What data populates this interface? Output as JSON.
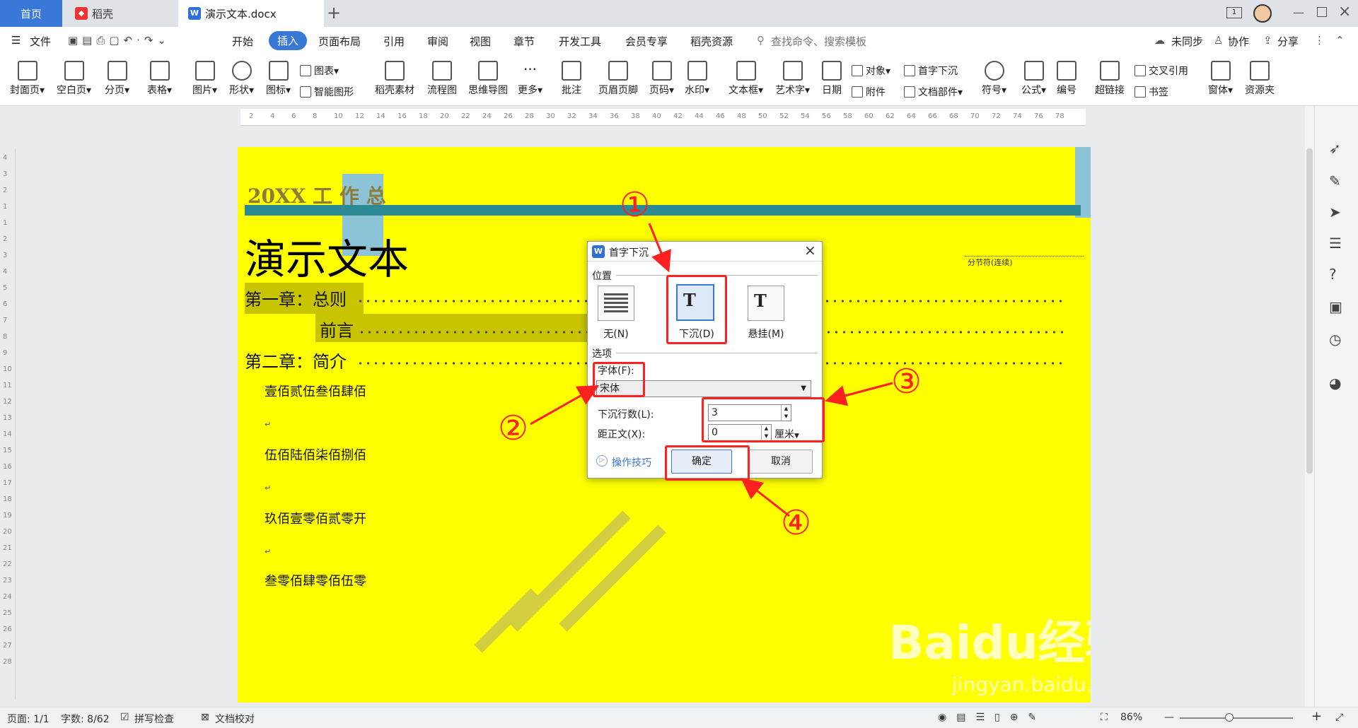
{
  "titlebar": {
    "home": "首页",
    "daoke": "稻壳",
    "doc_tab": "演示文本.docx",
    "add_tab": "+",
    "badge": "1"
  },
  "menu": {
    "file": "文件",
    "start": "开始",
    "insert": "插入",
    "layout": "页面布局",
    "ref": "引用",
    "review": "审阅",
    "view": "视图",
    "chapter": "章节",
    "dev": "开发工具",
    "member": "会员专享",
    "daoke_res": "稻壳资源",
    "search": "查找命令、搜索模板",
    "sync": "未同步",
    "collab": "协作",
    "share": "分享"
  },
  "ribbon": {
    "cover": "封面页",
    "blank": "空白页",
    "pagebreak": "分页",
    "table": "表格",
    "picture": "图片",
    "shape": "形状",
    "icon": "图标",
    "chart": "图表",
    "smartart": "智能图形",
    "material": "稻壳素材",
    "flow": "流程图",
    "mind": "思维导图",
    "more": "更多",
    "comment": "批注",
    "headerfooter": "页眉页脚",
    "pagenum": "页码",
    "watermark": "水印",
    "textbox": "文本框",
    "wordart": "艺术字",
    "date": "日期",
    "object": "对象",
    "attach": "附件",
    "dropcap": "首字下沉",
    "docpart": "文档部件",
    "symbol": "符号",
    "formula": "公式",
    "number": "编号",
    "crossref": "交叉引用",
    "hyperlink": "超链接",
    "bookmark": "书签",
    "window": "窗体",
    "resource": "资源夹"
  },
  "ruler_ticks": [
    "2",
    "4",
    "6",
    "8",
    "10",
    "12",
    "14",
    "16",
    "18",
    "20",
    "22",
    "24",
    "26",
    "28",
    "30",
    "32",
    "34",
    "36",
    "38",
    "40",
    "42",
    "44",
    "46",
    "48",
    "50",
    "52",
    "54",
    "56",
    "58",
    "60",
    "62",
    "64",
    "66",
    "68",
    "70",
    "72",
    "74",
    "76",
    "78"
  ],
  "vruler_ticks": [
    "4",
    "3",
    "2",
    "1",
    "1",
    "2",
    "3",
    "4",
    "5",
    "6",
    "7",
    "8",
    "9",
    "10",
    "11",
    "12",
    "13",
    "14",
    "15",
    "16",
    "17",
    "18",
    "19",
    "20",
    "21",
    "22",
    "23",
    "24",
    "25",
    "26",
    "27",
    "28"
  ],
  "doc": {
    "header": "20XX 工 作 总",
    "title": "演示文本",
    "section_break": "分节符(连续)",
    "toc": [
      {
        "text": "第一章：总则"
      },
      {
        "text": "前言"
      },
      {
        "text": "第二章：简介"
      }
    ],
    "lines": [
      "壹佰贰伍叁佰肆佰",
      "伍佰陆佰柒佰捌佰",
      "玖佰壹零佰贰零开",
      "叁零佰肆零佰伍零"
    ],
    "mark": "↵"
  },
  "dialog": {
    "title": "首字下沉",
    "position_label": "位置",
    "pos_none": "无(N)",
    "pos_drop": "下沉(D)",
    "pos_margin": "悬挂(M)",
    "options_label": "选项",
    "font_label": "字体(F):",
    "font_value": "宋体",
    "lines_label": "下沉行数(L):",
    "lines_value": "3",
    "distance_label": "距正文(X):",
    "distance_value": "0",
    "unit": "厘米",
    "tips": "操作技巧",
    "ok": "确定",
    "cancel": "取消"
  },
  "annotations": [
    "①",
    "②",
    "③",
    "④"
  ],
  "status": {
    "page": "页面: 1/1",
    "words": "字数: 8/62",
    "spell": "拼写检查",
    "proof": "文档校对",
    "zoom": "86%"
  },
  "watermark": {
    "text": "Baidu经验",
    "url": "jingyan.baidu.com"
  },
  "colors": {
    "accent": "#3a78d8",
    "page_bg": "#ffff00",
    "annotation": "#ff2020",
    "header_bar": "#2b8a94",
    "highlight": "#c8c400"
  }
}
